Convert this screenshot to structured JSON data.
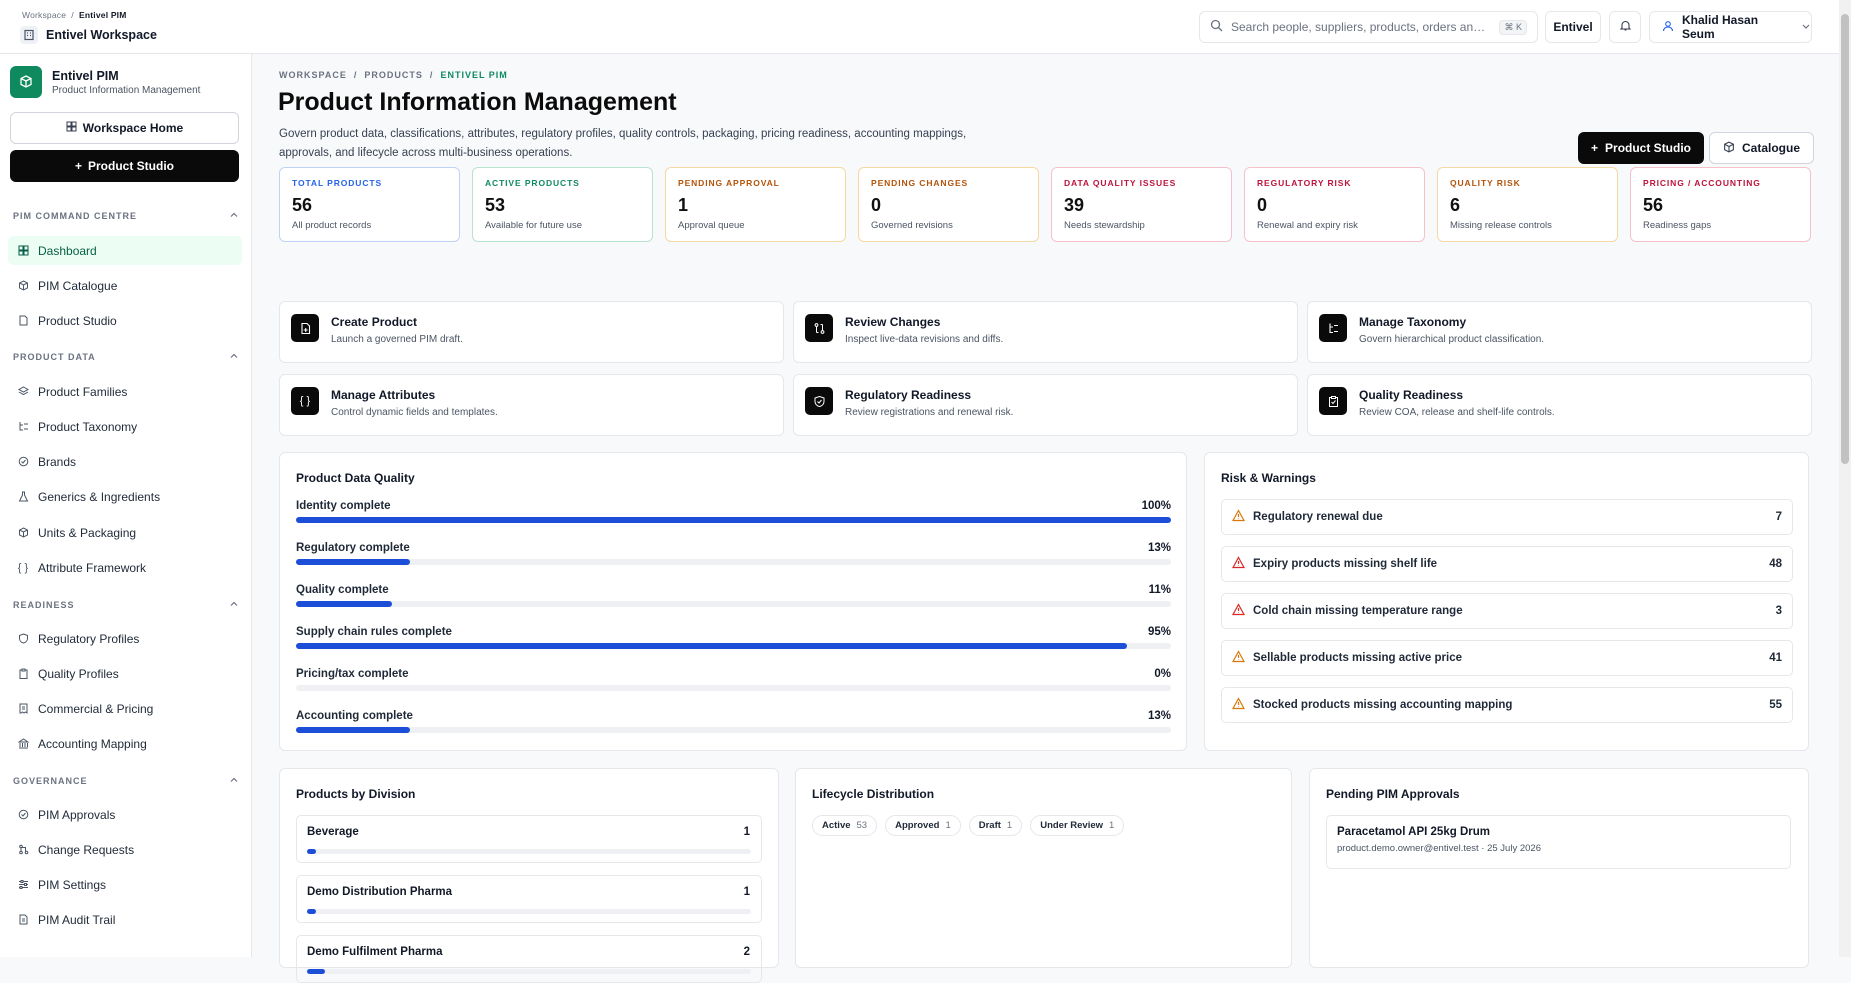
{
  "topbar": {
    "crumb_root": "Workspace",
    "crumb_sep": "/",
    "crumb_current": "Entivel PIM",
    "workspace": "Entivel Workspace",
    "search_placeholder": "Search people, suppliers, products, orders and ...",
    "search_kbd": "⌘ K",
    "entity": "Entivel",
    "user": "Khalid Hasan Seum"
  },
  "sidebar": {
    "app_name": "Entivel PIM",
    "app_sub": "Product Information Management",
    "home_btn": "Workspace Home",
    "studio_btn": "Product Studio",
    "sections": [
      {
        "title": "PIM COMMAND CENTRE",
        "items": [
          {
            "label": "Dashboard",
            "icon": "grid-icon"
          },
          {
            "label": "PIM Catalogue",
            "icon": "box-icon"
          },
          {
            "label": "Product Studio",
            "icon": "file-icon"
          }
        ]
      },
      {
        "title": "PRODUCT DATA",
        "items": [
          {
            "label": "Product Families",
            "icon": "layers-icon"
          },
          {
            "label": "Product Taxonomy",
            "icon": "tree-icon"
          },
          {
            "label": "Brands",
            "icon": "badge-icon"
          },
          {
            "label": "Generics & Ingredients",
            "icon": "flask-icon"
          },
          {
            "label": "Units & Packaging",
            "icon": "package-icon"
          },
          {
            "label": "Attribute Framework",
            "icon": "braces-icon"
          }
        ]
      },
      {
        "title": "READINESS",
        "items": [
          {
            "label": "Regulatory Profiles",
            "icon": "shield-icon"
          },
          {
            "label": "Quality Profiles",
            "icon": "clipboard-icon"
          },
          {
            "label": "Commercial & Pricing",
            "icon": "receipt-icon"
          },
          {
            "label": "Accounting Mapping",
            "icon": "bank-icon"
          }
        ]
      },
      {
        "title": "GOVERNANCE",
        "items": [
          {
            "label": "PIM Approvals",
            "icon": "check-circle-icon"
          },
          {
            "label": "Change Requests",
            "icon": "git-icon"
          },
          {
            "label": "PIM Settings",
            "icon": "sliders-icon"
          },
          {
            "label": "PIM Audit Trail",
            "icon": "log-icon"
          }
        ]
      }
    ]
  },
  "page": {
    "crumbs": [
      "WORKSPACE",
      "PRODUCTS",
      "ENTIVEL PIM"
    ],
    "crumb_sep": "/",
    "title": "Product Information Management",
    "description": "Govern product data, classifications, attributes, regulatory profiles, quality controls, packaging, pricing readiness, accounting mappings, approvals, and lifecycle across multi-business operations.",
    "studio_btn": "Product Studio",
    "catalogue_btn": "Catalogue"
  },
  "kpis": [
    {
      "label": "TOTAL PRODUCTS",
      "value": "56",
      "sub": "All product records",
      "color": "#2563eb",
      "border": "#bfd3f6"
    },
    {
      "label": "ACTIVE PRODUCTS",
      "value": "53",
      "sub": "Available for future use",
      "color": "#0f8a5f",
      "border": "#b7e4cf"
    },
    {
      "label": "PENDING APPROVAL",
      "value": "1",
      "sub": "Approval queue",
      "color": "#b45309",
      "border": "#f5d9a3"
    },
    {
      "label": "PENDING CHANGES",
      "value": "0",
      "sub": "Governed revisions",
      "color": "#b45309",
      "border": "#f5d9a3"
    },
    {
      "label": "DATA QUALITY ISSUES",
      "value": "39",
      "sub": "Needs stewardship",
      "color": "#be123c",
      "border": "#f5c2cc"
    },
    {
      "label": "REGULATORY RISK",
      "value": "0",
      "sub": "Renewal and expiry risk",
      "color": "#be123c",
      "border": "#f5c2cc"
    },
    {
      "label": "QUALITY RISK",
      "value": "6",
      "sub": "Missing release controls",
      "color": "#b45309",
      "border": "#f5d9a3"
    },
    {
      "label": "PRICING / ACCOUNTING",
      "value": "56",
      "sub": "Readiness gaps",
      "color": "#be123c",
      "border": "#f5c2cc"
    }
  ],
  "actions": [
    {
      "title": "Create Product",
      "sub": "Launch a governed PIM draft.",
      "icon": "file-plus-icon"
    },
    {
      "title": "Review Changes",
      "sub": "Inspect live-data revisions and diffs.",
      "icon": "git-compare-icon"
    },
    {
      "title": "Manage Taxonomy",
      "sub": "Govern hierarchical product classification.",
      "icon": "tree-icon"
    },
    {
      "title": "Manage Attributes",
      "sub": "Control dynamic fields and templates.",
      "icon": "braces-icon"
    },
    {
      "title": "Regulatory Readiness",
      "sub": "Review registrations and renewal risk.",
      "icon": "shield-icon"
    },
    {
      "title": "Quality Readiness",
      "sub": "Review COA, release and shelf-life controls.",
      "icon": "clipboard-check-icon"
    }
  ],
  "quality": {
    "title": "Product Data Quality",
    "rows": [
      {
        "label": "Identity complete",
        "pct": 100,
        "text": "100%"
      },
      {
        "label": "Regulatory complete",
        "pct": 13,
        "text": "13%"
      },
      {
        "label": "Quality complete",
        "pct": 11,
        "text": "11%"
      },
      {
        "label": "Supply chain rules complete",
        "pct": 95,
        "text": "95%"
      },
      {
        "label": "Pricing/tax complete",
        "pct": 0,
        "text": "0%"
      },
      {
        "label": "Accounting complete",
        "pct": 13,
        "text": "13%"
      }
    ]
  },
  "risks": {
    "title": "Risk & Warnings",
    "rows": [
      {
        "label": "Regulatory renewal due",
        "count": "7",
        "color": "#d97706"
      },
      {
        "label": "Expiry products missing shelf life",
        "count": "48",
        "color": "#dc2626"
      },
      {
        "label": "Cold chain missing temperature range",
        "count": "3",
        "color": "#dc2626"
      },
      {
        "label": "Sellable products missing active price",
        "count": "41",
        "color": "#d97706"
      },
      {
        "label": "Stocked products missing accounting mapping",
        "count": "55",
        "color": "#d97706"
      }
    ]
  },
  "divisions": {
    "title": "Products by Division",
    "rows": [
      {
        "label": "Beverage",
        "count": "1",
        "pct": 2
      },
      {
        "label": "Demo Distribution Pharma",
        "count": "1",
        "pct": 2
      },
      {
        "label": "Demo Fulfilment Pharma",
        "count": "2",
        "pct": 4
      }
    ]
  },
  "lifecycle": {
    "title": "Lifecycle Distribution",
    "chips": [
      {
        "label": "Active",
        "count": "53"
      },
      {
        "label": "Approved",
        "count": "1"
      },
      {
        "label": "Draft",
        "count": "1"
      },
      {
        "label": "Under Review",
        "count": "1"
      }
    ]
  },
  "approvals": {
    "title": "Pending PIM Approvals",
    "item_name": "Paracetamol API 25kg Drum",
    "item_meta": "product.demo.owner@entivel.test · 25 July 2026"
  }
}
